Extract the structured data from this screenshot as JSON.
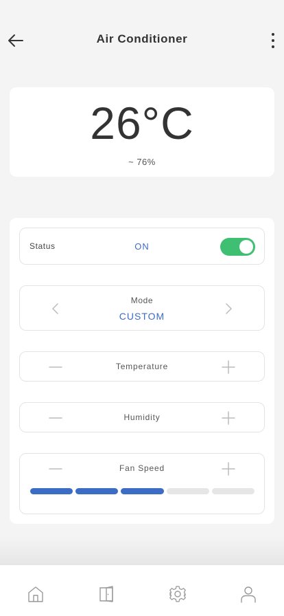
{
  "header": {
    "title": "Air Conditioner",
    "back_icon": "arrow-left-icon",
    "more_icon": "more-vertical-icon"
  },
  "reading": {
    "temperature": "26°C",
    "humidity": "~ 76%"
  },
  "status": {
    "label": "Status",
    "value": "ON",
    "toggle_on": true
  },
  "mode": {
    "label": "Mode",
    "value": "CUSTOM"
  },
  "temperature_row": {
    "label": "Temperature"
  },
  "humidity_row": {
    "label": "Humidity"
  },
  "fan_speed": {
    "label": "Fan Speed",
    "level": 3,
    "max_level": 5
  },
  "nav": {
    "items": [
      "home-icon",
      "door-icon",
      "settings-icon",
      "user-icon"
    ]
  },
  "colors": {
    "accent": "#3c6cc4",
    "toggle_on": "#3fbf72",
    "background": "#f4f4f4"
  }
}
